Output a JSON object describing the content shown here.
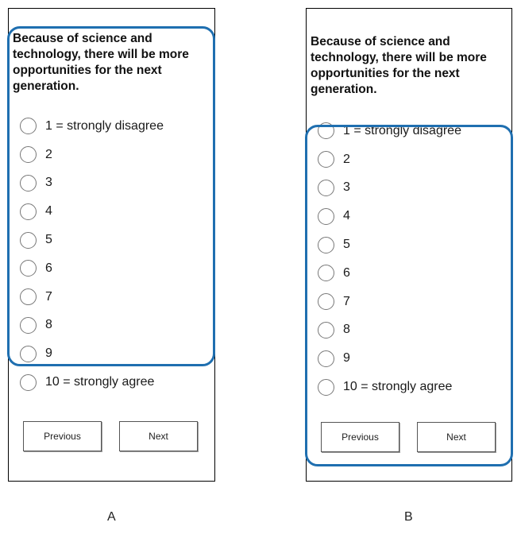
{
  "panels": [
    {
      "id": "A",
      "label": "A",
      "question": "Because of science and technology, there will be more opportunities for the next generation.",
      "options": [
        "1 = strongly disagree",
        "2",
        "3",
        "4",
        "5",
        "6",
        "7",
        "8",
        "9",
        "10 = strongly agree"
      ],
      "buttons": {
        "previous": "Previous",
        "next": "Next"
      },
      "highlight": "question and options 1–9"
    },
    {
      "id": "B",
      "label": "B",
      "question": "Because of science and technology, there will be more opportunities for the next generation.",
      "options": [
        "1 = strongly disagree",
        "2",
        "3",
        "4",
        "5",
        "6",
        "7",
        "8",
        "9",
        "10 = strongly agree"
      ],
      "buttons": {
        "previous": "Previous",
        "next": "Next"
      },
      "highlight": "options 2–10 and navigation buttons"
    }
  ],
  "colors": {
    "highlight": "#1f6fb0",
    "radio_border": "#777777",
    "frame": "#000000"
  }
}
